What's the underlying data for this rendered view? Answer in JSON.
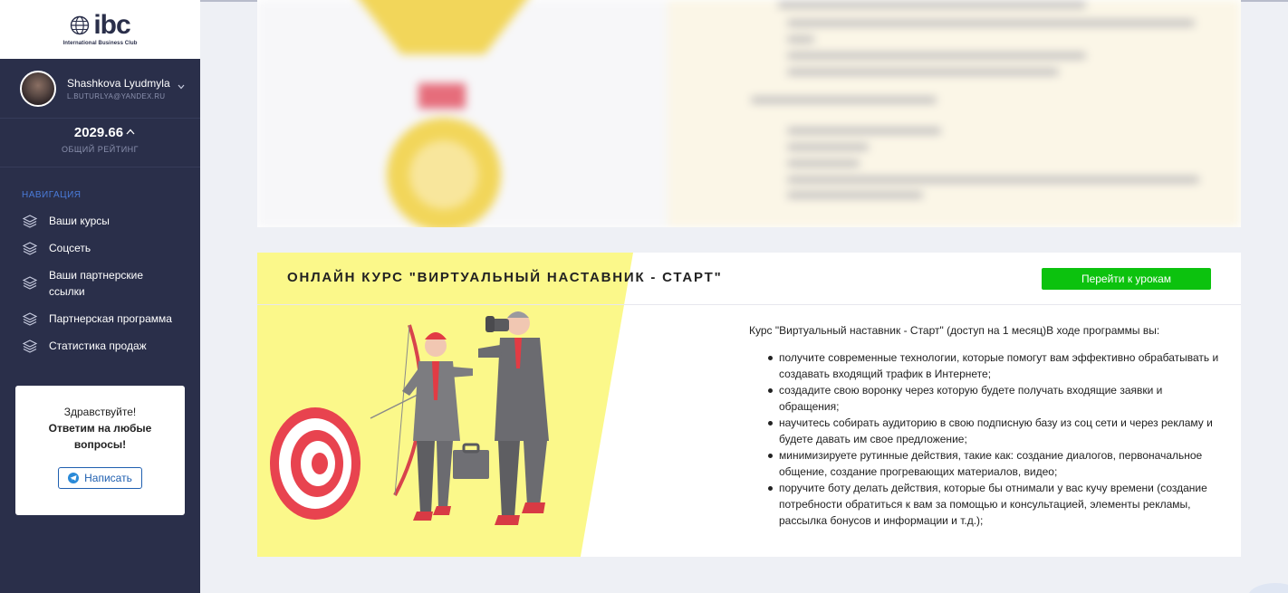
{
  "brand": {
    "logo_text": "ibc",
    "logo_subtitle": "International Business Club"
  },
  "user": {
    "name": "Shashkova Lyudmyla",
    "email": "L.BUTURLYA@YANDEX.RU"
  },
  "rating": {
    "value": "2029.66",
    "label": "ОБЩИЙ РЕЙТИНГ"
  },
  "nav": {
    "heading": "НАВИГАЦИЯ",
    "items": [
      {
        "label": "Ваши курсы",
        "icon": "layers-icon"
      },
      {
        "label": "Соцсеть",
        "icon": "layers-icon"
      },
      {
        "label": "Ваши партнерские ссылки",
        "icon": "layers-icon"
      },
      {
        "label": "Партнерская программа",
        "icon": "layers-icon"
      },
      {
        "label": "Статистика продаж",
        "icon": "layers-icon"
      }
    ]
  },
  "chat": {
    "greeting": "Здравствуйте!",
    "subtitle": "Ответим на любые вопросы!",
    "button_label": "Написать"
  },
  "course": {
    "title": "ОНЛАЙН КУРС \"ВИРТУАЛЬНЫЙ НАСТАВНИК - СТАРТ\"",
    "button_label": "Перейти к урокам",
    "intro": "Курс \"Виртуальный наставник - Старт\" (доступ на 1 месяц)В ходе программы вы:",
    "bullets": [
      "получите современные технологии, которые помогут вам эффективно обрабатывать и создавать входящий трафик в Интернете;",
      "создадите свою воронку через которую будете получать входящие заявки и обращения;",
      "научитесь собирать аудиторию в свою подписную базу из соц сети и через рекламу и будете давать им свое предложение;",
      "минимизируете рутинные действия, такие как: создание диалогов, первоначальное общение, создание прогревающих материалов, видео;",
      "поручите боту делать действия, которые бы отнимали у вас кучу времени (создание потребности обратиться к вам за помощью и консультацией, элементы рекламы, рассылка бонусов и информации и т.д.);"
    ]
  },
  "colors": {
    "sidebar": "#2a2f4a",
    "accent_blue": "#4a7bd9",
    "cta_green": "#0cc20e",
    "banner_yellow": "#fbf88a"
  }
}
